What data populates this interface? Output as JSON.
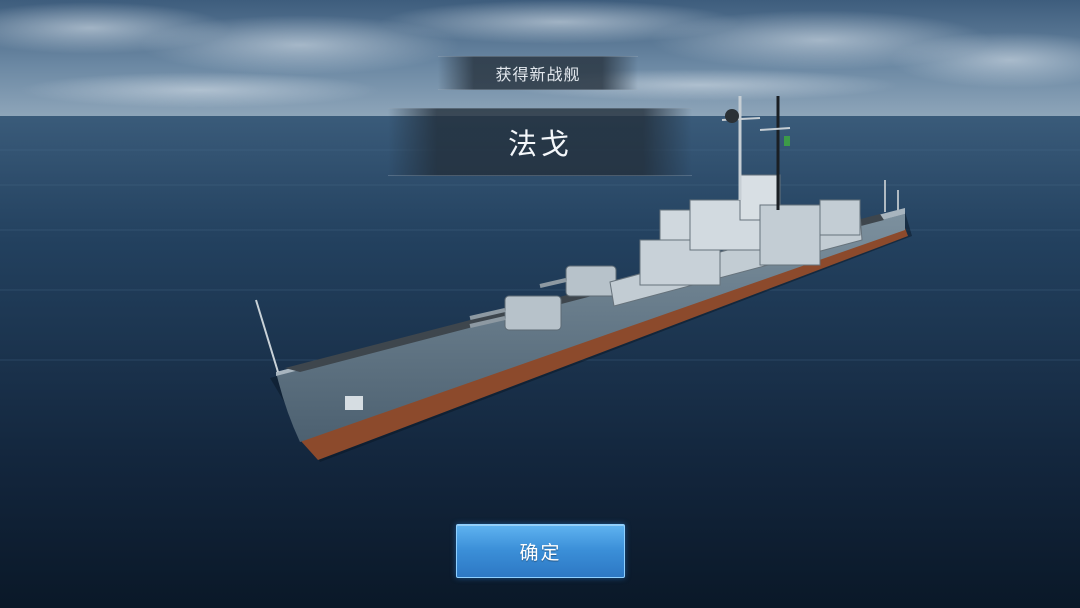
{
  "dialog": {
    "title": "获得新战舰",
    "ship_name": "法戈",
    "confirm_label": "确定"
  },
  "scene": {
    "sky_color": "#4f6f8f",
    "sea_color": "#16324e",
    "hull_color": "#5f7585"
  }
}
